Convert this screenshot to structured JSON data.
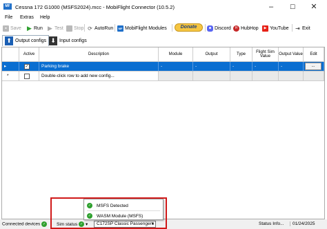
{
  "window": {
    "title": "Cessna 172 G1000 (MSFS2024).mcc - MobiFlight Connector (10.5.2)",
    "icon_text": "MF"
  },
  "menu": [
    "File",
    "Extras",
    "Help"
  ],
  "toolbar": {
    "save": "Save",
    "run": "Run",
    "test": "Test",
    "stop": "Stop",
    "autorun": "AutoRun",
    "modules": "MobiFlight Modules",
    "donate": "Donate",
    "discord": "Discord",
    "hubhop": "HubHop",
    "youtube": "YouTube",
    "exit": "Exit"
  },
  "tabs": {
    "output": "Output configs",
    "input": "Input configs"
  },
  "grid": {
    "headers": [
      "Active",
      "Description",
      "Module",
      "Output",
      "Type",
      "Flight Sim Value",
      "Output Value",
      "Edit"
    ],
    "rows": [
      {
        "marker": "▸",
        "active": true,
        "description": "Parking brake",
        "module": "-",
        "output": "-",
        "type": "-",
        "sim_value": "-",
        "out_value": "-",
        "edit": "..."
      },
      {
        "marker": "*",
        "active": false,
        "description": "Double-click row to add new config...",
        "module": "",
        "output": "",
        "type": "",
        "sim_value": "",
        "out_value": "",
        "edit": ""
      }
    ]
  },
  "popup": {
    "items": [
      "MSFS Detected",
      "WASM Module (MSFS)"
    ]
  },
  "status": {
    "connected_devices": "Connected devices",
    "sim_status": "Sim status",
    "aircraft": "C172SP Classic Passengers",
    "status_info": "Status Info...",
    "date": "01/24/2025"
  },
  "colors": {
    "selection": "#0a6ed1",
    "ok_green": "#2ea02e",
    "highlight_red": "#d01818",
    "donate_yellow": "#f5c542"
  }
}
